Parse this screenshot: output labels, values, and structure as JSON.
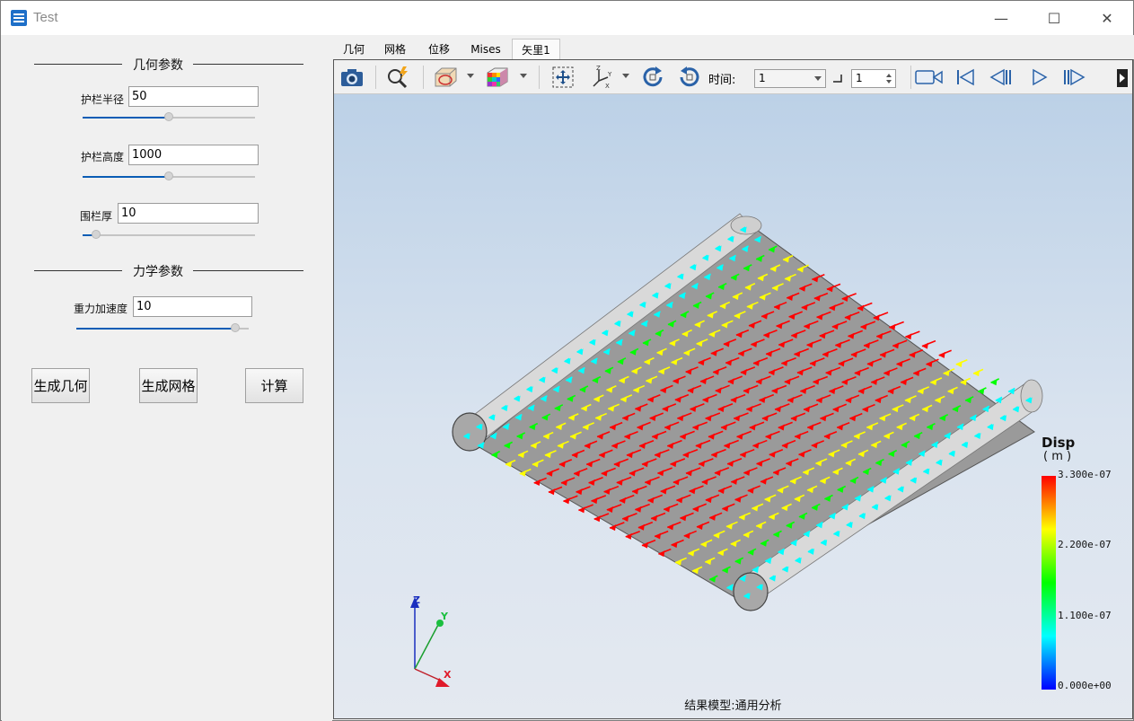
{
  "window": {
    "title": "Test",
    "minimize_glyph": "—",
    "maximize_glyph": "☐",
    "close_glyph": "✕"
  },
  "geometry_section": {
    "title": "几何参数",
    "params": [
      {
        "label": "护栏半径",
        "value": "50",
        "slider_fraction": 0.5
      },
      {
        "label": "护栏高度",
        "value": "1000",
        "slider_fraction": 0.5
      },
      {
        "label": "围栏厚",
        "value": "10",
        "slider_fraction": 0.08
      }
    ]
  },
  "mechanics_section": {
    "title": "力学参数",
    "params": [
      {
        "label": "重力加速度",
        "value": "10",
        "slider_fraction": 0.92
      }
    ]
  },
  "buttons": {
    "generate_geometry": "生成几何",
    "generate_mesh": "生成网格",
    "compute": "计算"
  },
  "tabs": [
    {
      "label": "几何",
      "active": false
    },
    {
      "label": "网格",
      "active": false
    },
    {
      "label": "位移",
      "active": false
    },
    {
      "label": "Mises",
      "active": false
    },
    {
      "label": "矢里1",
      "active": true
    }
  ],
  "toolbar": {
    "icons": [
      "camera-icon",
      "zoom-icon",
      "view-box-icon",
      "color-cube-icon",
      "fit-all-icon",
      "axes-view-icon",
      "rotate-cw-icon",
      "rotate-ccw-icon",
      "record-icon",
      "first-frame-icon",
      "prev-frame-icon",
      "play-icon",
      "next-frame-icon"
    ],
    "time_label": "时间:",
    "time_value": "1",
    "step_value": "1"
  },
  "legend": {
    "title": "Disp",
    "unit": "( m )",
    "ticks": [
      "3.300e-07",
      "2.200e-07",
      "1.100e-07",
      "0.000e+00"
    ],
    "colors": [
      "#ff0000",
      "#ffff00",
      "#00ff00",
      "#00ffff",
      "#0000ff"
    ]
  },
  "axes": {
    "z": "Z",
    "y": "Y",
    "x": "X"
  },
  "status": "结果模型:通用分析"
}
